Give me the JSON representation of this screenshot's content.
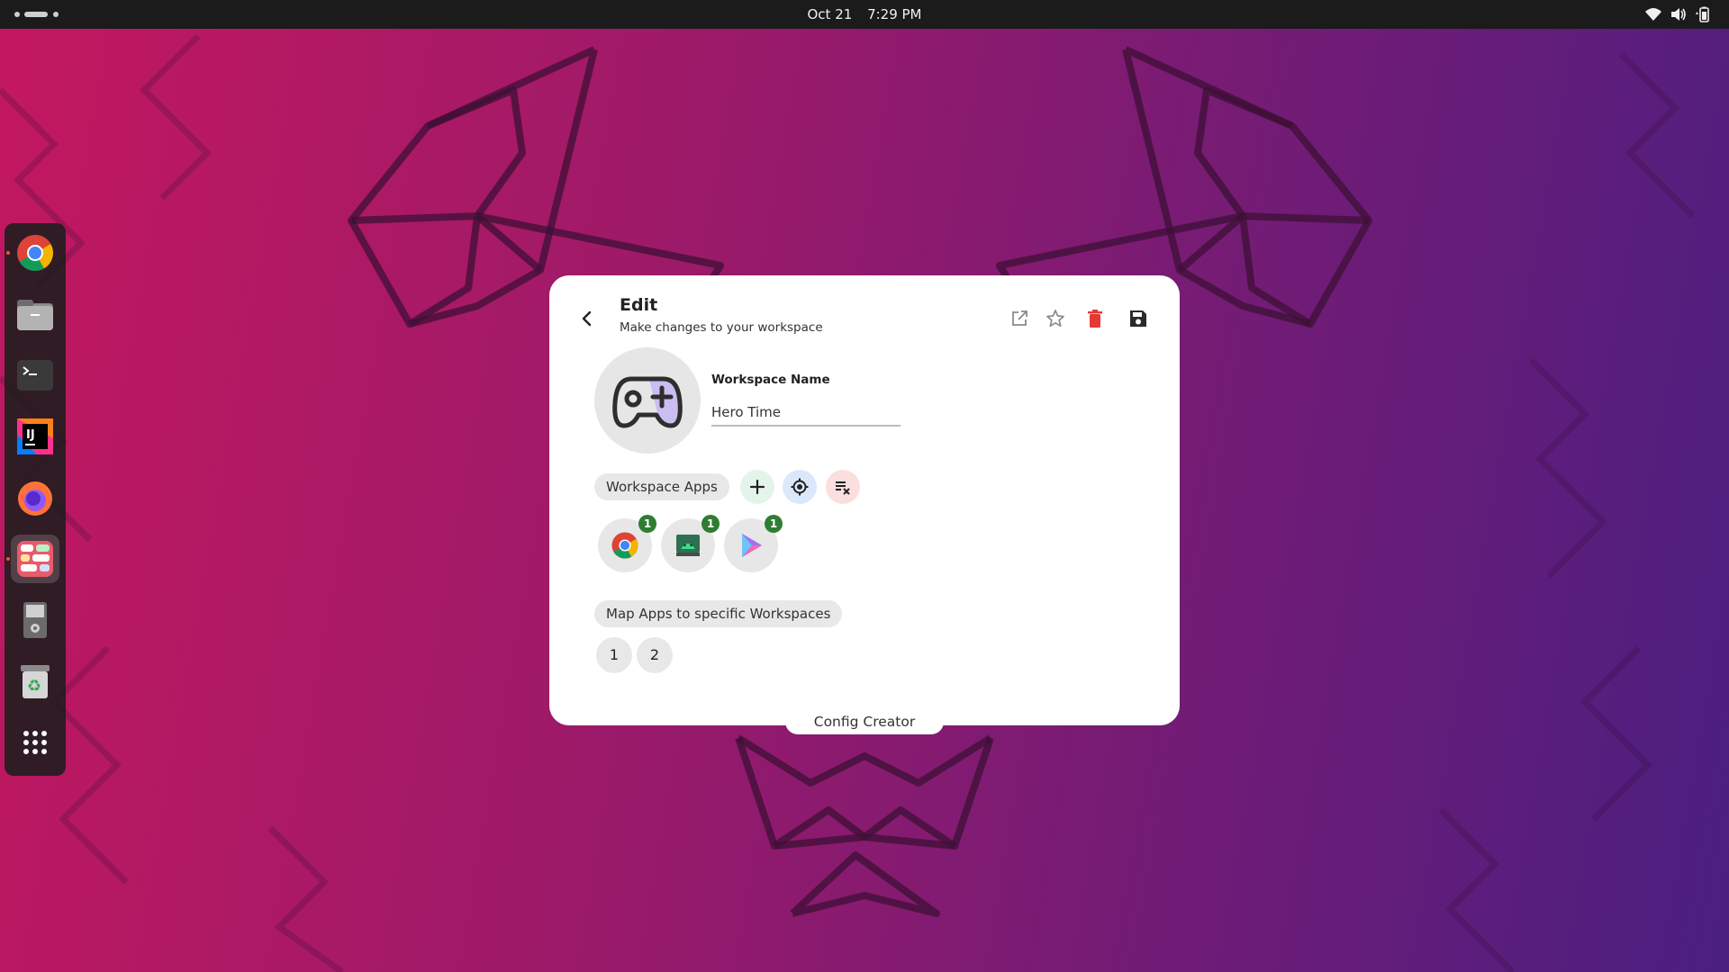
{
  "topbar": {
    "date": "Oct 21",
    "time": "7:29 PM",
    "tray_icons": [
      "wifi-icon",
      "volume-icon",
      "battery-icon"
    ]
  },
  "dock": {
    "items": [
      {
        "name": "chrome",
        "icon": "chrome-icon",
        "running": true,
        "active": false
      },
      {
        "name": "files",
        "icon": "folder-icon",
        "running": false,
        "active": false
      },
      {
        "name": "terminal",
        "icon": "terminal-icon",
        "running": false,
        "active": false
      },
      {
        "name": "intellij",
        "icon": "intellij-icon",
        "running": false,
        "active": false
      },
      {
        "name": "firefox",
        "icon": "firefox-icon",
        "running": false,
        "active": false
      },
      {
        "name": "config-creator",
        "icon": "grid-app-icon",
        "running": true,
        "active": true
      },
      {
        "name": "removable-drive",
        "icon": "drive-icon",
        "running": false,
        "active": false
      },
      {
        "name": "trash",
        "icon": "trash-icon",
        "running": false,
        "active": false
      },
      {
        "name": "show-apps",
        "icon": "apps-grid-icon",
        "running": false,
        "active": false
      }
    ]
  },
  "dialog": {
    "title": "Edit",
    "subtitle": "Make changes to your workspace",
    "field_label": "Workspace Name",
    "field_value": "Hero Time",
    "apps_chip": "Workspace Apps",
    "map_chip": "Map Apps to specific Workspaces",
    "apps": [
      {
        "name": "chrome",
        "icon": "chrome-icon",
        "count": "1"
      },
      {
        "name": "android-studio",
        "icon": "android-icon",
        "count": "1"
      },
      {
        "name": "play-store",
        "icon": "play-icon",
        "count": "1"
      }
    ],
    "workspaces": [
      "1",
      "2"
    ],
    "colors": {
      "delete": "#e53935",
      "add_bg": "#e3f5ea",
      "locate_bg": "#dbe8fb",
      "clear_bg": "#fbdede",
      "badge": "#2e7d32"
    }
  },
  "footer": {
    "label": "Config Creator"
  }
}
